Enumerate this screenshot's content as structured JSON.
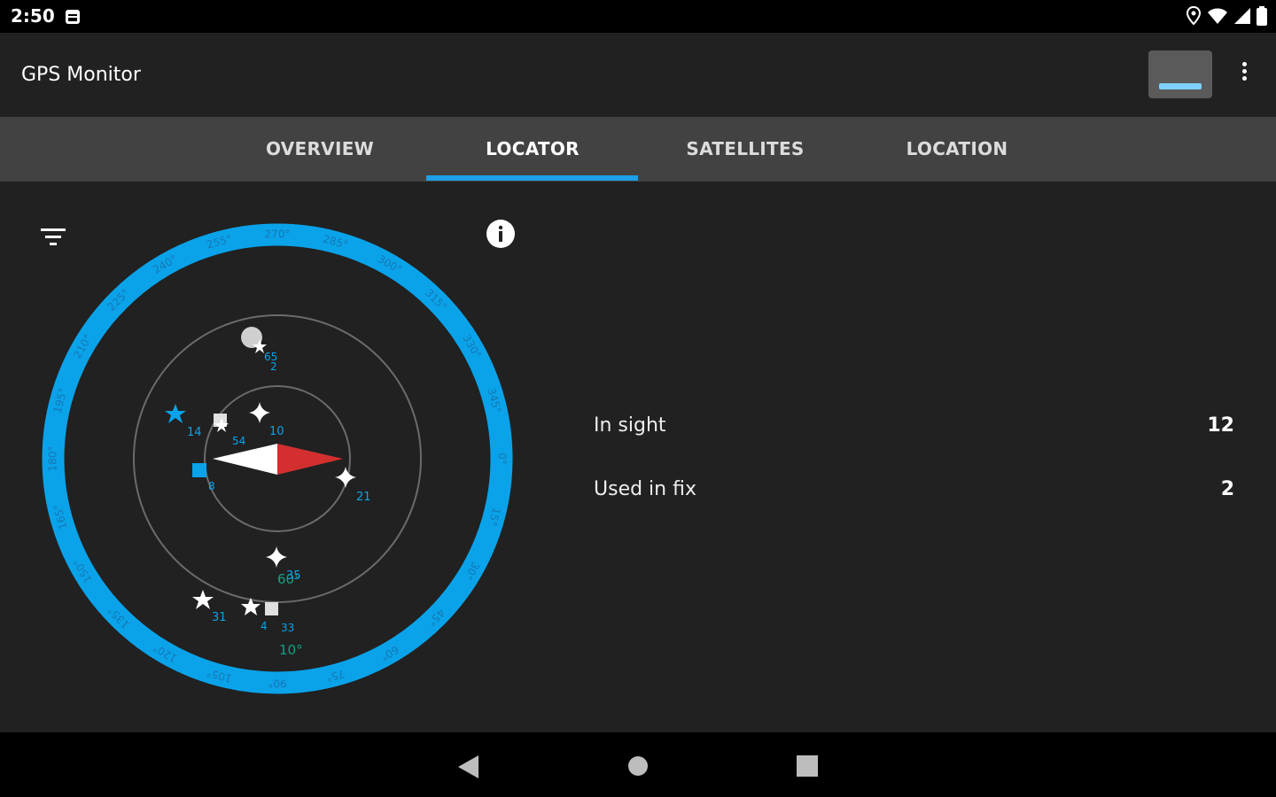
{
  "status": {
    "time": "2:50"
  },
  "app": {
    "title": "GPS Monitor"
  },
  "tabs": [
    {
      "label": "OVERVIEW",
      "active": false
    },
    {
      "label": "LOCATOR",
      "active": true
    },
    {
      "label": "SATELLITES",
      "active": false
    },
    {
      "label": "LOCATION",
      "active": false
    }
  ],
  "colors": {
    "accent": "#1e9fe8",
    "ring": "#0aa3ea",
    "needle_red": "#d32f2f",
    "green_label": "#16a085"
  },
  "stats": {
    "in_sight_label": "In sight",
    "in_sight_value": "12",
    "used_label": "Used in fix",
    "used_value": "2"
  },
  "radar": {
    "degree_labels": [
      "270°",
      "285°",
      "300°",
      "315°",
      "330°",
      "345°",
      "0°",
      "15°",
      "30°",
      "45°",
      "60°",
      "75°",
      "90°",
      "105°",
      "120°",
      "135°",
      "150°",
      "165°",
      "180°",
      "195°",
      "210°",
      "225°",
      "240°",
      "255°"
    ],
    "elevation_labels": [
      "60°",
      "10°"
    ],
    "satellites": [
      {
        "id": "65",
        "shape": "circle",
        "sub": "2"
      },
      {
        "id": "14",
        "shape": "star"
      },
      {
        "id": "54",
        "shape": "square"
      },
      {
        "id": "10",
        "shape": "sparkle"
      },
      {
        "id": "8",
        "shape": "rect"
      },
      {
        "id": "21",
        "shape": "sparkle"
      },
      {
        "id": "35",
        "shape": "sparkle"
      },
      {
        "id": "31",
        "shape": "star"
      },
      {
        "id": "4",
        "shape": "star"
      },
      {
        "id": "33",
        "shape": "square"
      }
    ]
  },
  "icons": [
    "filter-icon",
    "info-icon",
    "location-icon",
    "wifi-icon",
    "signal-icon",
    "battery-icon",
    "back-icon",
    "home-icon",
    "recents-icon",
    "overflow-menu-icon"
  ]
}
